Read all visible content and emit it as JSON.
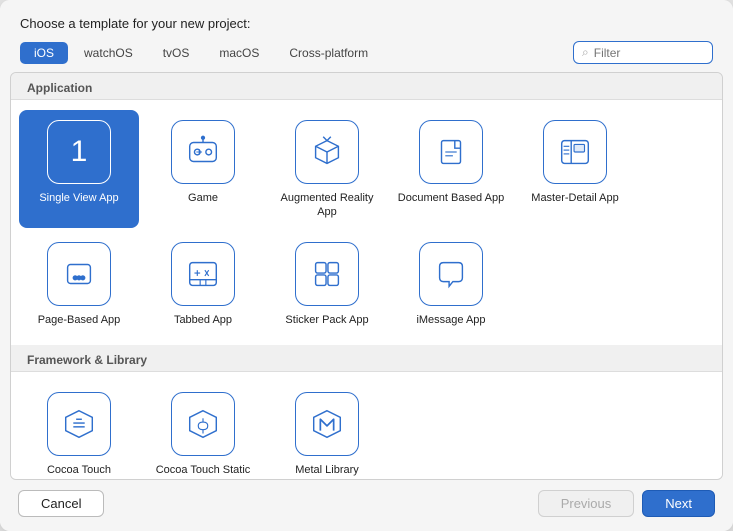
{
  "dialog": {
    "title": "Choose a template for your new project:",
    "tabs": [
      {
        "label": "iOS",
        "active": true
      },
      {
        "label": "watchOS",
        "active": false
      },
      {
        "label": "tvOS",
        "active": false
      },
      {
        "label": "macOS",
        "active": false
      },
      {
        "label": "Cross-platform",
        "active": false
      }
    ],
    "filter_placeholder": "Filter"
  },
  "sections": [
    {
      "header": "Application",
      "items": [
        {
          "id": "single-view-app",
          "label": "Single View App",
          "icon": "number-1",
          "selected": true
        },
        {
          "id": "game",
          "label": "Game",
          "icon": "game"
        },
        {
          "id": "augmented-reality-app",
          "label": "Augmented Reality App",
          "icon": "ar"
        },
        {
          "id": "document-based-app",
          "label": "Document Based App",
          "icon": "doc"
        },
        {
          "id": "master-detail-app",
          "label": "Master-Detail App",
          "icon": "master-detail"
        },
        {
          "id": "page-based-app",
          "label": "Page-Based App",
          "icon": "page-based"
        },
        {
          "id": "tabbed-app",
          "label": "Tabbed App",
          "icon": "tabbed"
        },
        {
          "id": "sticker-pack-app",
          "label": "Sticker Pack App",
          "icon": "sticker"
        },
        {
          "id": "imessage-app",
          "label": "iMessage App",
          "icon": "imessage"
        }
      ]
    },
    {
      "header": "Framework & Library",
      "items": [
        {
          "id": "cocoa-touch-framework",
          "label": "Cocoa Touch Framework",
          "icon": "cocoa-framework"
        },
        {
          "id": "cocoa-touch-static-library",
          "label": "Cocoa Touch Static Library",
          "icon": "cocoa-static"
        },
        {
          "id": "metal-library",
          "label": "Metal Library",
          "icon": "metal"
        }
      ]
    }
  ],
  "footer": {
    "cancel_label": "Cancel",
    "previous_label": "Previous",
    "next_label": "Next"
  }
}
